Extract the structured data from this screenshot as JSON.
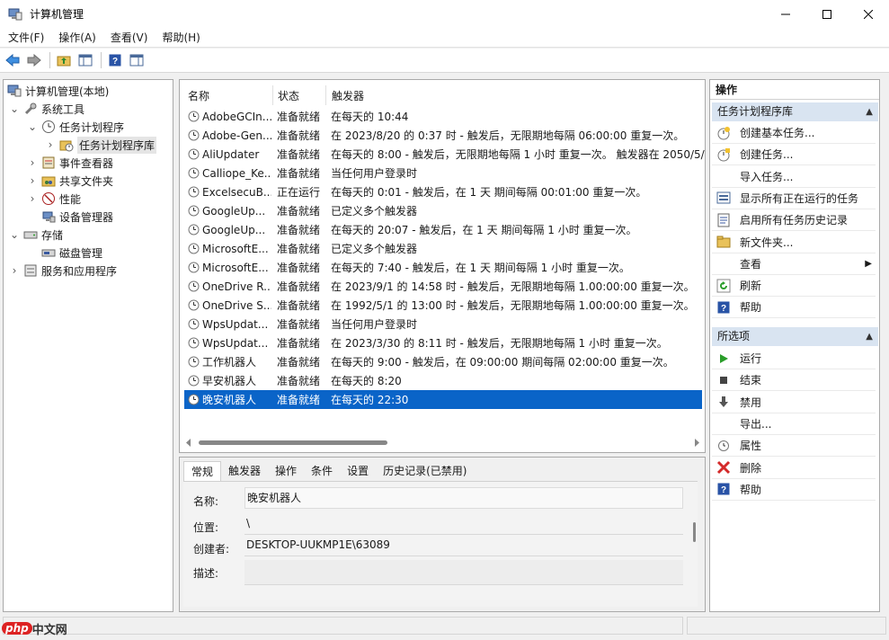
{
  "window": {
    "title": "计算机管理",
    "controls": [
      "minimize",
      "maximize",
      "close"
    ]
  },
  "menu": [
    "文件(F)",
    "操作(A)",
    "查看(V)",
    "帮助(H)"
  ],
  "toolbar_icons": [
    "back-arrow-icon",
    "forward-arrow-icon",
    "up-folder-icon",
    "show-hide-tree-icon",
    "help-icon",
    "show-action-pane-icon"
  ],
  "tree": [
    {
      "label": "计算机管理(本地)",
      "icon": "computer-mgmt-icon",
      "level": 0,
      "arrow": ""
    },
    {
      "label": "系统工具",
      "icon": "tools-icon",
      "level": 1,
      "arrow": "expanded"
    },
    {
      "label": "任务计划程序",
      "icon": "clock-icon",
      "level": 2,
      "arrow": "expanded"
    },
    {
      "label": "任务计划程序库",
      "icon": "folder-clock-icon",
      "level": 3,
      "arrow": "collapsed",
      "selected": true
    },
    {
      "label": "事件查看器",
      "icon": "event-viewer-icon",
      "level": 2,
      "arrow": "collapsed"
    },
    {
      "label": "共享文件夹",
      "icon": "shared-folder-icon",
      "level": 2,
      "arrow": "collapsed"
    },
    {
      "label": "性能",
      "icon": "performance-icon",
      "level": 2,
      "arrow": "collapsed"
    },
    {
      "label": "设备管理器",
      "icon": "device-manager-icon",
      "level": 2,
      "arrow": ""
    },
    {
      "label": "存储",
      "icon": "storage-icon",
      "level": 1,
      "arrow": "expanded"
    },
    {
      "label": "磁盘管理",
      "icon": "disk-icon",
      "level": 2,
      "arrow": ""
    },
    {
      "label": "服务和应用程序",
      "icon": "services-icon",
      "level": 1,
      "arrow": "collapsed"
    }
  ],
  "task_list": {
    "columns": [
      "名称",
      "状态",
      "触发器"
    ],
    "rows": [
      {
        "name": "AdobeGCIn...",
        "status": "准备就绪",
        "trigger": "在每天的 10:44"
      },
      {
        "name": "Adobe-Gen...",
        "status": "准备就绪",
        "trigger": "在 2023/8/20 的 0:37 时 - 触发后，无限期地每隔 06:00:00 重复一次。"
      },
      {
        "name": "AliUpdater",
        "status": "准备就绪",
        "trigger": "在每天的 8:00 - 触发后，无限期地每隔 1 小时 重复一次。 触发器在 2050/5/"
      },
      {
        "name": "Calliope_Ke...",
        "status": "准备就绪",
        "trigger": "当任何用户登录时"
      },
      {
        "name": "ExcelsecuB...",
        "status": "正在运行",
        "trigger": "在每天的 0:01 - 触发后，在 1 天 期间每隔 00:01:00 重复一次。"
      },
      {
        "name": "GoogleUp...",
        "status": "准备就绪",
        "trigger": "已定义多个触发器"
      },
      {
        "name": "GoogleUp...",
        "status": "准备就绪",
        "trigger": "在每天的 20:07 - 触发后，在 1 天 期间每隔 1 小时 重复一次。"
      },
      {
        "name": "MicrosoftE...",
        "status": "准备就绪",
        "trigger": "已定义多个触发器"
      },
      {
        "name": "MicrosoftE...",
        "status": "准备就绪",
        "trigger": "在每天的 7:40 - 触发后，在 1 天 期间每隔 1 小时 重复一次。"
      },
      {
        "name": "OneDrive R...",
        "status": "准备就绪",
        "trigger": "在 2023/9/1 的 14:58 时 - 触发后，无限期地每隔 1.00:00:00 重复一次。"
      },
      {
        "name": "OneDrive S...",
        "status": "准备就绪",
        "trigger": "在 1992/5/1 的 13:00 时 - 触发后，无限期地每隔 1.00:00:00 重复一次。"
      },
      {
        "name": "WpsUpdat...",
        "status": "准备就绪",
        "trigger": "当任何用户登录时"
      },
      {
        "name": "WpsUpdat...",
        "status": "准备就绪",
        "trigger": "在 2023/3/30 的 8:11 时 - 触发后，无限期地每隔 1 小时 重复一次。"
      },
      {
        "name": "工作机器人",
        "status": "准备就绪",
        "trigger": "在每天的 9:00 - 触发后，在 09:00:00 期间每隔 02:00:00 重复一次。"
      },
      {
        "name": "早安机器人",
        "status": "准备就绪",
        "trigger": "在每天的 8:20"
      },
      {
        "name": "晚安机器人",
        "status": "准备就绪",
        "trigger": "在每天的 22:30",
        "selected": true
      }
    ]
  },
  "detail": {
    "tabs": [
      "常规",
      "触发器",
      "操作",
      "条件",
      "设置",
      "历史记录(已禁用)"
    ],
    "active_tab": "常规",
    "fields": [
      {
        "label": "名称:",
        "value": "晚安机器人"
      },
      {
        "label": "位置:",
        "value": "\\"
      },
      {
        "label": "创建者:",
        "value": "DESKTOP-UUKMP1E\\63089"
      },
      {
        "label": "描述:",
        "value": ""
      }
    ]
  },
  "actions": {
    "header": "操作",
    "section1": {
      "title": "任务计划程序库",
      "items": [
        {
          "label": "创建基本任务...",
          "icon": "create-basic-task-icon"
        },
        {
          "label": "创建任务...",
          "icon": "create-task-icon"
        },
        {
          "label": "导入任务...",
          "icon": ""
        },
        {
          "label": "显示所有正在运行的任务",
          "icon": "running-tasks-icon"
        },
        {
          "label": "启用所有任务历史记录",
          "icon": "history-icon"
        },
        {
          "label": "新文件夹...",
          "icon": "new-folder-icon"
        },
        {
          "label": "查看",
          "icon": "",
          "submenu": true
        },
        {
          "label": "刷新",
          "icon": "refresh-icon"
        },
        {
          "label": "帮助",
          "icon": "help-icon"
        }
      ]
    },
    "section2": {
      "title": "所选项",
      "items": [
        {
          "label": "运行",
          "icon": "run-icon"
        },
        {
          "label": "结束",
          "icon": "stop-icon"
        },
        {
          "label": "禁用",
          "icon": "disable-icon"
        },
        {
          "label": "导出...",
          "icon": ""
        },
        {
          "label": "属性",
          "icon": "properties-icon"
        },
        {
          "label": "删除",
          "icon": "delete-icon"
        },
        {
          "label": "帮助",
          "icon": "help-icon"
        }
      ]
    }
  },
  "watermark": "php中文网",
  "colors": {
    "selection": "#0a64c8",
    "section_bg": "#d9e4f1",
    "run_green": "#2a9d2a",
    "delete_red": "#d42a2a",
    "help_blue": "#2953a6"
  }
}
